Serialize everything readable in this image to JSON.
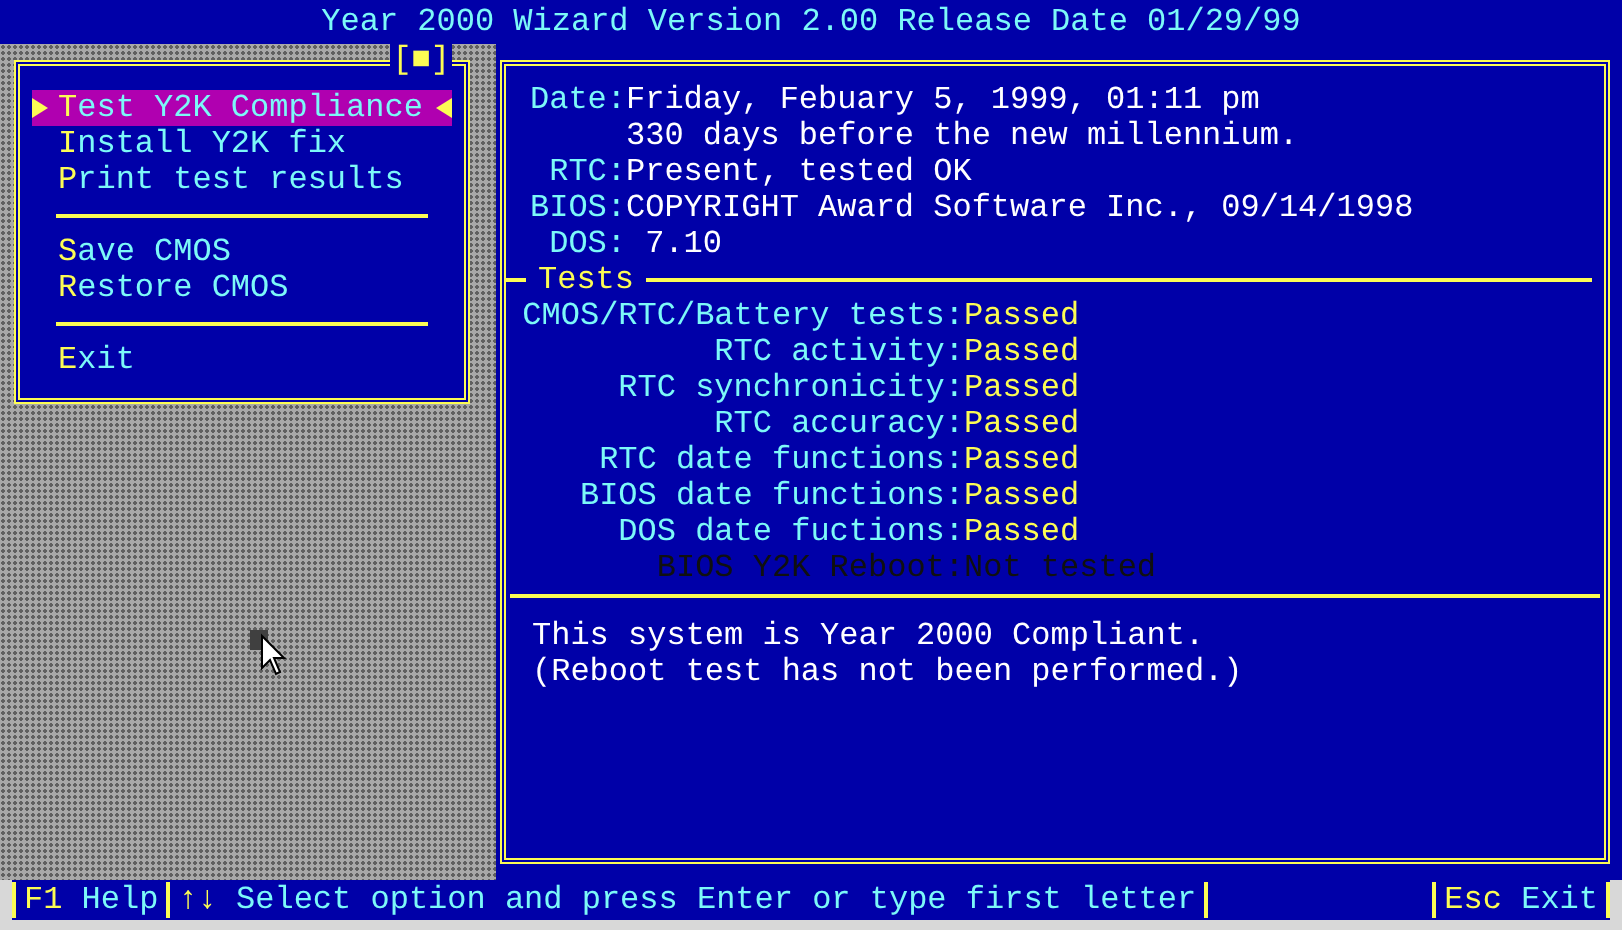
{
  "window": {
    "title": "Year 2000 Wizard Version 2.00 Release Date 01/29/99"
  },
  "menu": {
    "close_box": "[■]",
    "items": [
      {
        "kind": "item",
        "label": "Test Y2K Compliance",
        "selected": true
      },
      {
        "kind": "item",
        "label": "Install Y2K fix",
        "selected": false
      },
      {
        "kind": "item",
        "label": "Print test results",
        "selected": false
      },
      {
        "kind": "divider"
      },
      {
        "kind": "item",
        "label": "Save CMOS",
        "selected": false
      },
      {
        "kind": "item",
        "label": "Restore CMOS",
        "selected": false
      },
      {
        "kind": "divider"
      },
      {
        "kind": "item",
        "label": "Exit",
        "selected": false
      }
    ]
  },
  "info": [
    {
      "label": "Date:",
      "value": "Friday, Febuary 5, 1999, 01:11 pm"
    },
    {
      "value": "330 days before the new millennium."
    },
    {
      "label": "RTC:",
      "value": "Present, tested OK"
    },
    {
      "label": "BIOS:",
      "value": "COPYRIGHT Award Software Inc., 09/14/1998"
    },
    {
      "label": "DOS:",
      "value": " 7.10"
    }
  ],
  "tests": {
    "title": "Tests",
    "rows": [
      {
        "label": "CMOS/RTC/Battery tests:",
        "result": "Passed",
        "disabled": false
      },
      {
        "label": "RTC activity:",
        "result": "Passed",
        "disabled": false
      },
      {
        "label": "RTC synchronicity:",
        "result": "Passed",
        "disabled": false
      },
      {
        "label": "RTC accuracy:",
        "result": "Passed",
        "disabled": false
      },
      {
        "label": "RTC date functions:",
        "result": "Passed",
        "disabled": false
      },
      {
        "label": "BIOS date functions:",
        "result": "Passed",
        "disabled": false
      },
      {
        "label": "DOS date fuctions:",
        "result": "Passed",
        "disabled": false
      },
      {
        "label": "BIOS Y2K Reboot:",
        "result": "Not tested",
        "disabled": true
      }
    ]
  },
  "summary": [
    "This system is Year 2000 Compliant.",
    "(Reboot test has not been performed.)"
  ],
  "status_bar": [
    {
      "key": "F1",
      "label": "Help"
    },
    {
      "key": "↑↓",
      "label": "Select option and press Enter or type first letter"
    },
    {
      "key": "Esc",
      "label": "Exit"
    }
  ]
}
